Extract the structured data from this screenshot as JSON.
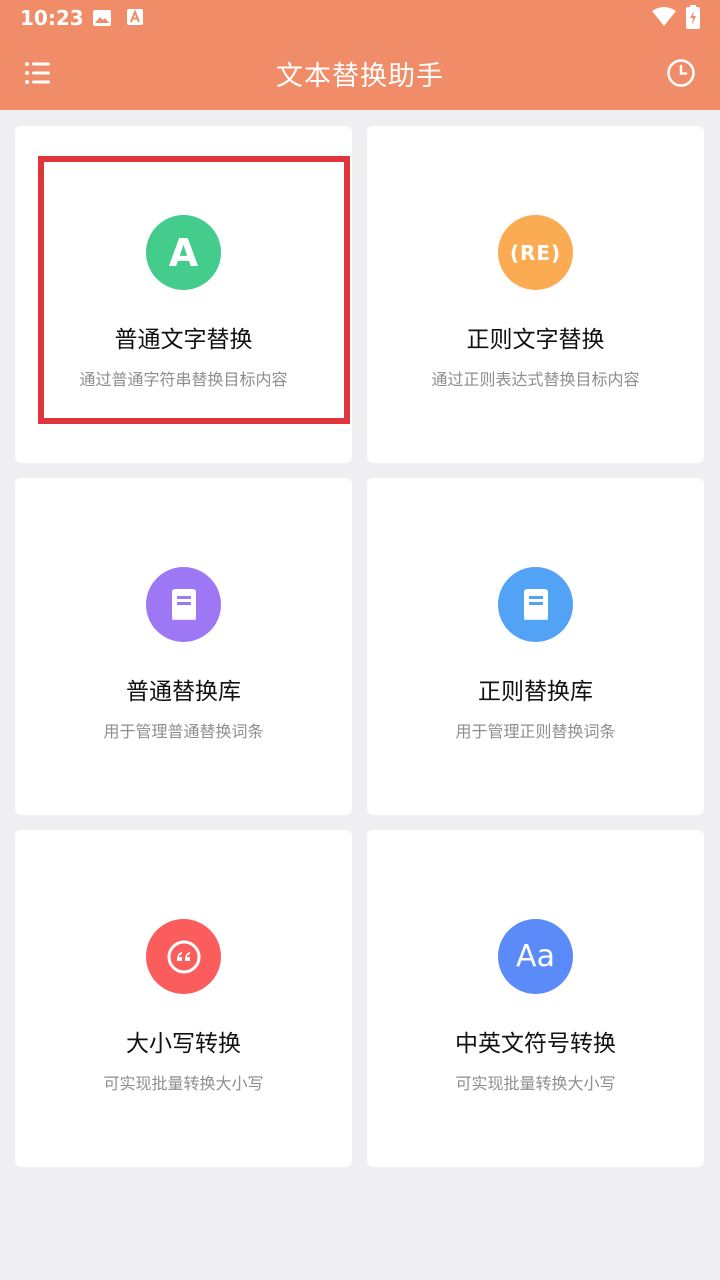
{
  "status_bar": {
    "time": "10:23"
  },
  "app_bar": {
    "title": "文本替换助手"
  },
  "cards": [
    {
      "title": "普通文字替换",
      "subtitle": "通过普通字符串替换目标内容",
      "icon": "letter-a-icon",
      "icon_text": "A",
      "color": "#43cc8c"
    },
    {
      "title": "正则文字替换",
      "subtitle": "通过正则表达式替换目标内容",
      "icon": "regex-icon",
      "icon_text": "(RE)",
      "color": "#fbab52"
    },
    {
      "title": "普通替换库",
      "subtitle": "用于管理普通替换词条",
      "icon": "book-icon",
      "color": "#9e78f4"
    },
    {
      "title": "正则替换库",
      "subtitle": "用于管理正则替换词条",
      "icon": "book-icon",
      "color": "#52a2f6"
    },
    {
      "title": "大小写转换",
      "subtitle": "可实现批量转换大小写",
      "icon": "quote-icon",
      "color": "#fb5c5c"
    },
    {
      "title": "中英文符号转换",
      "subtitle": "可实现批量转换大小写",
      "icon": "aa-icon",
      "icon_text": "Aa",
      "color": "#5b8bf8"
    }
  ],
  "colors": {
    "accent": "#f08c68",
    "highlight": "#e0353a",
    "background": "#efeff1"
  }
}
